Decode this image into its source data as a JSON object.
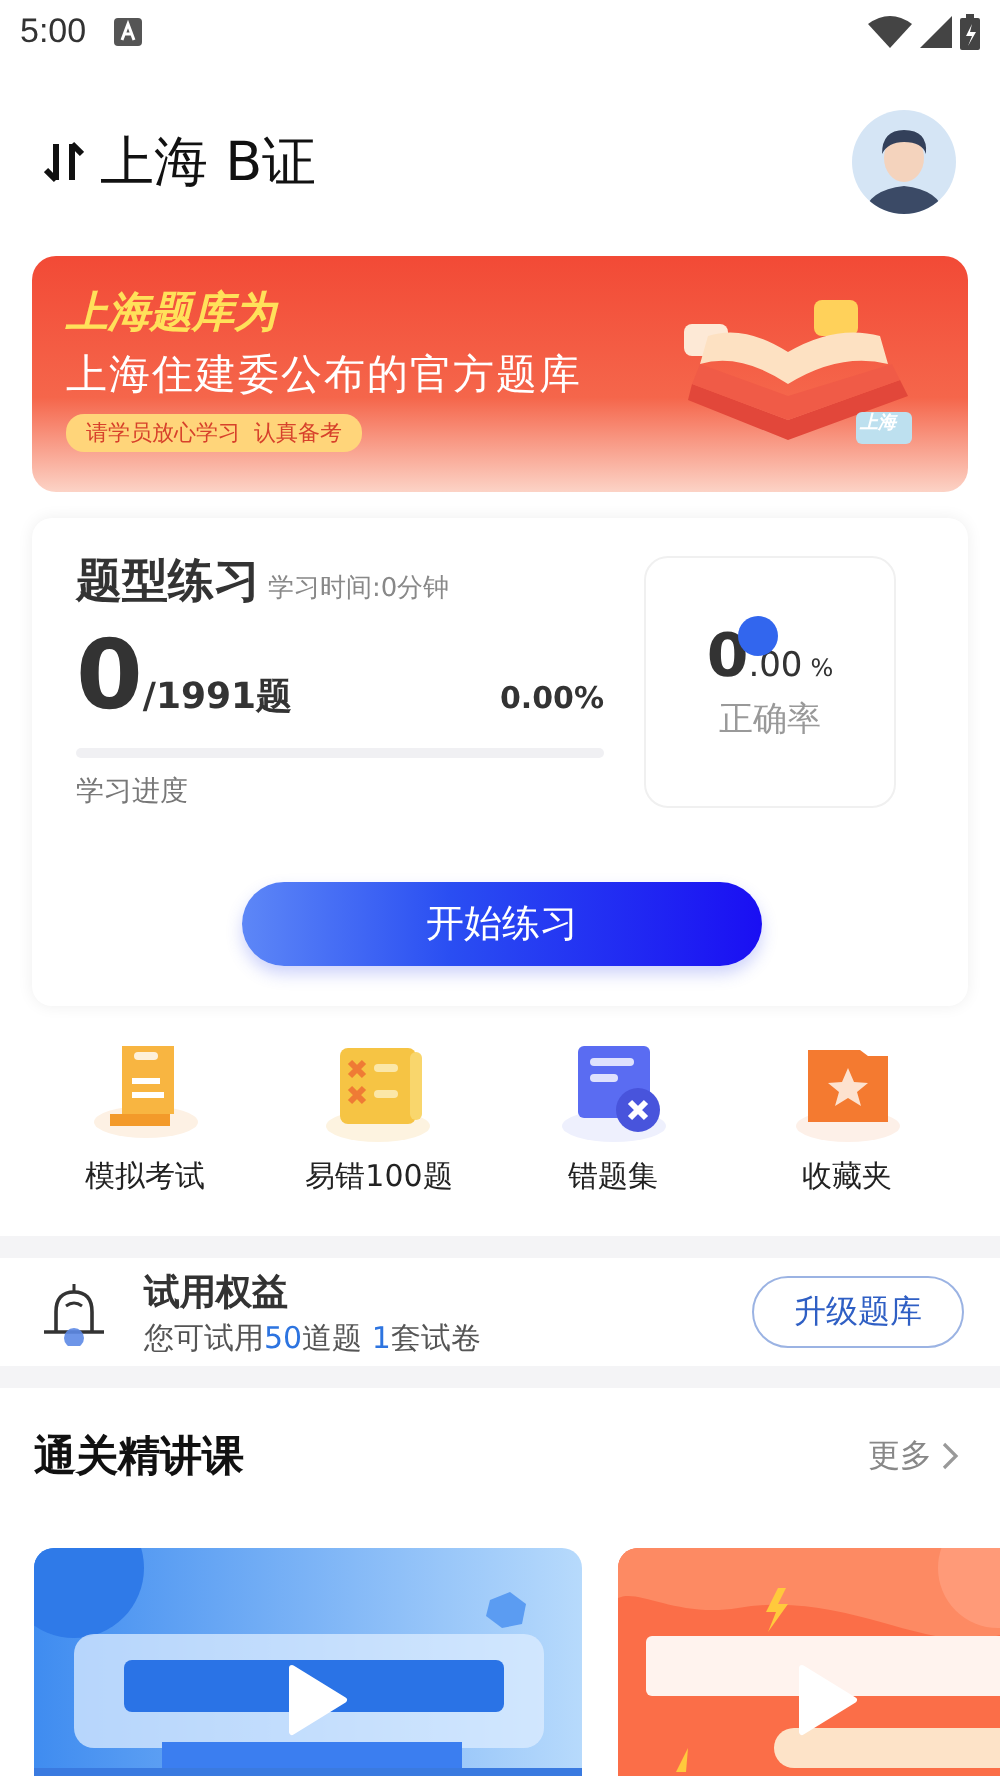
{
  "status_bar": {
    "time": "5:00"
  },
  "header": {
    "title": "上海 B证"
  },
  "banner": {
    "headline": "上海题库为",
    "subline": "上海住建委公布的官方题库",
    "tag": "请学员放心学习  认真备考",
    "book_label": "上海"
  },
  "practice": {
    "title": "题型练习",
    "study_time": "学习时间:0分钟",
    "done": "0",
    "total": "/1991题",
    "percent": "0.00%",
    "progress_label": "学习进度",
    "level": 0,
    "accuracy": {
      "whole": "0",
      "decimal": ".00",
      "unit": "%",
      "label": "正确率"
    },
    "start_button": "开始练习"
  },
  "shortcuts": [
    {
      "kind": "exam",
      "label": "模拟考试"
    },
    {
      "kind": "mistakes",
      "label": "易错100题"
    },
    {
      "kind": "wrong",
      "label": "错题集"
    },
    {
      "kind": "favorites",
      "label": "收藏夹"
    }
  ],
  "trial": {
    "title": "试用权益",
    "detail": [
      {
        "text": "您可试用",
        "highlight": false
      },
      {
        "text": "50",
        "highlight": true
      },
      {
        "text": "道题 ",
        "highlight": false
      },
      {
        "text": "1",
        "highlight": true
      },
      {
        "text": "套试卷",
        "highlight": false
      }
    ],
    "button": "升级题库"
  },
  "courses": {
    "title": "通关精讲课",
    "more": "更多"
  }
}
